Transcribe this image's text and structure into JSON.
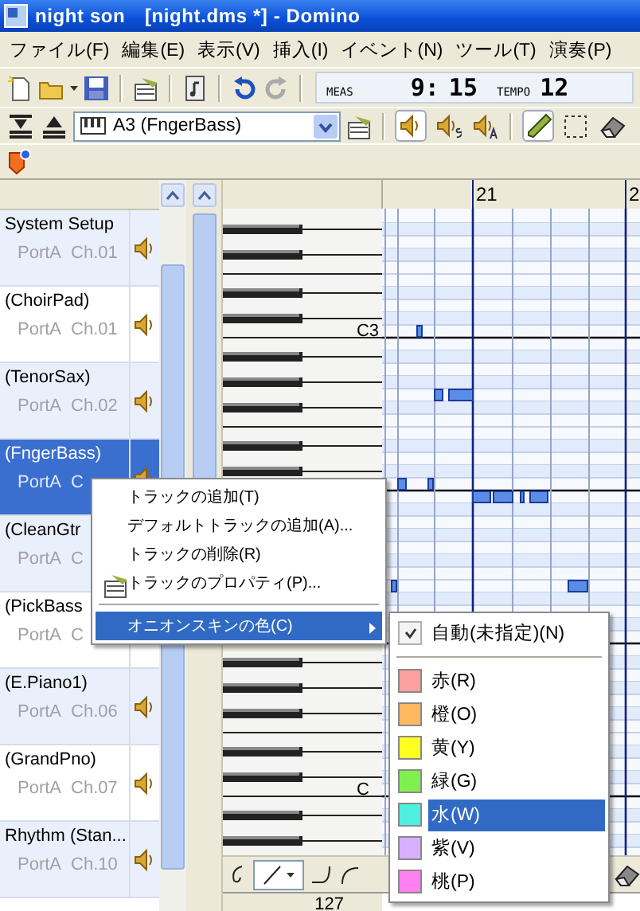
{
  "window": {
    "title": "night son　[night.dms *] - Domino"
  },
  "menu_bar": [
    "ファイル(F)",
    "編集(E)",
    "表示(V)",
    "挿入(I)",
    "イベント(N)",
    "ツール(T)",
    "演奏(P)"
  ],
  "counter": {
    "meas_label": "MEAS",
    "measure": "9:",
    "beat": "15",
    "tempo_label": "TEMPO",
    "tempo": "12"
  },
  "track_selector": {
    "value": "A3 (FngerBass)"
  },
  "play_modes": [
    {
      "kind": "normal",
      "selected": true
    },
    {
      "kind": "solo",
      "selected": false
    },
    {
      "kind": "all",
      "selected": false
    }
  ],
  "tools": [
    {
      "kind": "pencil",
      "selected": true
    },
    {
      "kind": "select",
      "selected": false
    },
    {
      "kind": "eraser",
      "selected": false
    }
  ],
  "tracks": [
    {
      "name": "System Setup",
      "port": "PortA",
      "channel": "Ch.01",
      "selected": false
    },
    {
      "name": "(ChoirPad)",
      "port": "PortA",
      "channel": "Ch.01",
      "selected": false
    },
    {
      "name": "(TenorSax)",
      "port": "PortA",
      "channel": "Ch.02",
      "selected": false
    },
    {
      "name": "(FngerBass)",
      "port": "PortA",
      "channel": "C",
      "selected": true
    },
    {
      "name": "(CleanGtr",
      "port": "PortA",
      "channel": "C",
      "selected": false
    },
    {
      "name": "(PickBass",
      "port": "PortA",
      "channel": "C",
      "selected": false
    },
    {
      "name": "(E.Piano1)",
      "port": "PortA",
      "channel": "Ch.06",
      "selected": false
    },
    {
      "name": "(GrandPno)",
      "port": "PortA",
      "channel": "Ch.07",
      "selected": false
    },
    {
      "name": "Rhythm (Stan...",
      "port": "PortA",
      "channel": "Ch.10",
      "selected": false
    }
  ],
  "ruler": {
    "measures": [
      "21",
      "2"
    ]
  },
  "keyboard": {
    "labels": [
      "C3",
      "C"
    ]
  },
  "velocity_ruler": {
    "label": "127"
  },
  "context_menu": {
    "items": [
      {
        "kind": "item",
        "label": "トラックの追加(T)",
        "selected": false
      },
      {
        "kind": "item",
        "label": "デフォルトトラックの追加(A)...",
        "selected": false
      },
      {
        "kind": "item",
        "label": "トラックの削除(R)",
        "selected": false
      },
      {
        "kind": "icon",
        "label": "トラックのプロパティ(P)...",
        "selected": false
      },
      {
        "kind": "separator"
      },
      {
        "kind": "submenu",
        "label": "オニオンスキンの色(C)",
        "selected": true
      }
    ]
  },
  "submenu": {
    "items": [
      {
        "kind": "check",
        "label": "自動(未指定)(N)",
        "checked": true
      },
      {
        "kind": "separator"
      },
      {
        "kind": "color",
        "label": "赤(R)",
        "color": "#ffa0a0",
        "selected": false
      },
      {
        "kind": "color",
        "label": "橙(O)",
        "color": "#ffb860",
        "selected": false
      },
      {
        "kind": "color",
        "label": "黄(Y)",
        "color": "#ffff20",
        "selected": false
      },
      {
        "kind": "color",
        "label": "緑(G)",
        "color": "#80f050",
        "selected": false
      },
      {
        "kind": "color",
        "label": "水(W)",
        "color": "#50f0e0",
        "selected": true
      },
      {
        "kind": "color",
        "label": "紫(V)",
        "color": "#d8b0ff",
        "selected": false
      },
      {
        "kind": "color",
        "label": "桃(P)",
        "color": "#ff80f0",
        "selected": false
      }
    ]
  }
}
